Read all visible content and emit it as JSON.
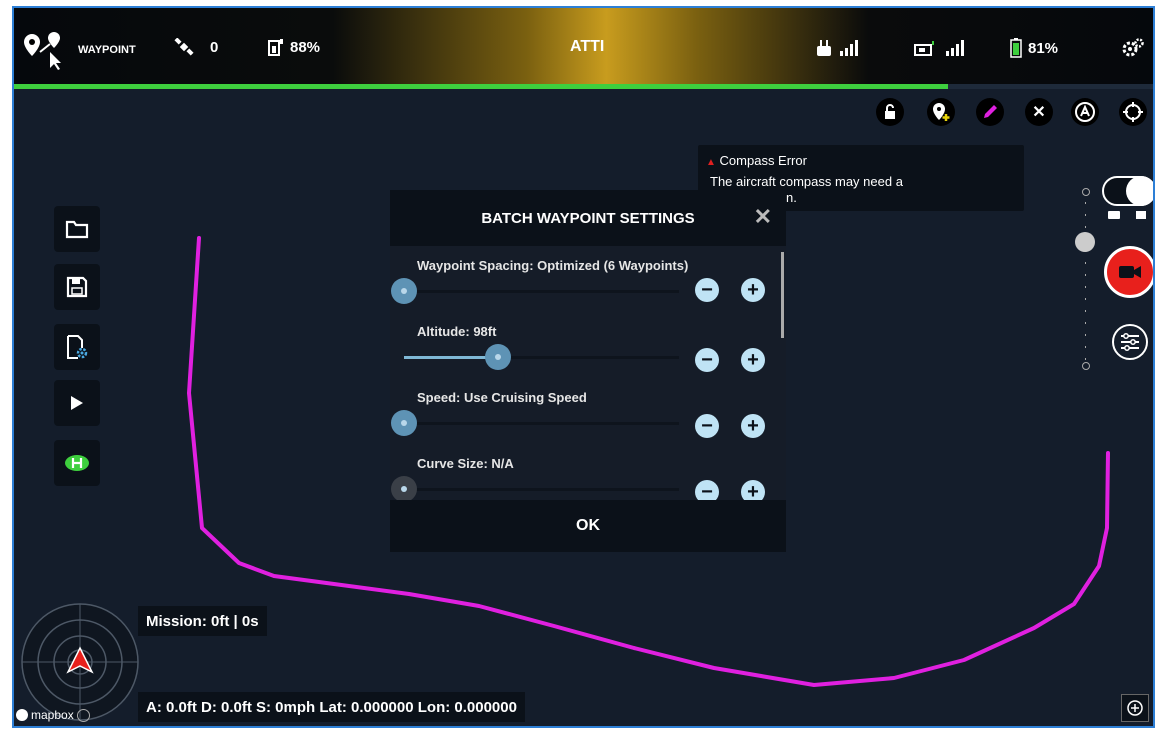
{
  "topbar": {
    "mode_label": "WAYPOINT",
    "satellites": "0",
    "rc_battery": "88%",
    "flight_mode": "ATTI",
    "aircraft_battery": "81%"
  },
  "icons": {
    "waypoint_mode": "waypoint-mode-icon",
    "satellite": "satellite-icon",
    "rc_battery": "controller-battery-icon",
    "rc_signal": "rc-signal-icon",
    "video_signal": "video-signal-icon",
    "battery": "battery-icon",
    "settings": "settings-gear-icon"
  },
  "top_progress": 0.82,
  "map_tools": [
    "lock-icon",
    "add-waypoint-icon",
    "edit-pencil-icon",
    "close-icon",
    "auto-icon",
    "crosshair-icon"
  ],
  "warning": {
    "title": "Compass Error",
    "body_line1": "The aircraft compass may need a",
    "body_line2": "n."
  },
  "dialog": {
    "title": "BATCH WAYPOINT SETTINGS",
    "ok_label": "OK",
    "rows": [
      {
        "label": "Waypoint Spacing: Optimized (6 Waypoints)",
        "value": 0.0
      },
      {
        "label": "Altitude: 98ft",
        "value": 0.34
      },
      {
        "label": "Speed: Use Cruising Speed",
        "value": 0.0
      },
      {
        "label": "Curve Size: N/A",
        "value": 0.0
      }
    ]
  },
  "left_toolbar": [
    "folder-icon",
    "save-icon",
    "mission-settings-icon",
    "play-icon",
    "home-icon"
  ],
  "mission": {
    "summary": "Mission: 0ft | 0s"
  },
  "telemetry": {
    "text": "A: 0.0ft D: 0.0ft S: 0mph Lat: 0.000000 Lon: 0.000000"
  },
  "attribution": {
    "text": "mapbox"
  },
  "colors": {
    "accent_green": "#3ecf3e",
    "flight_path": "#e020e0",
    "record_red": "#e8201c",
    "map_background": "#141d2b"
  }
}
